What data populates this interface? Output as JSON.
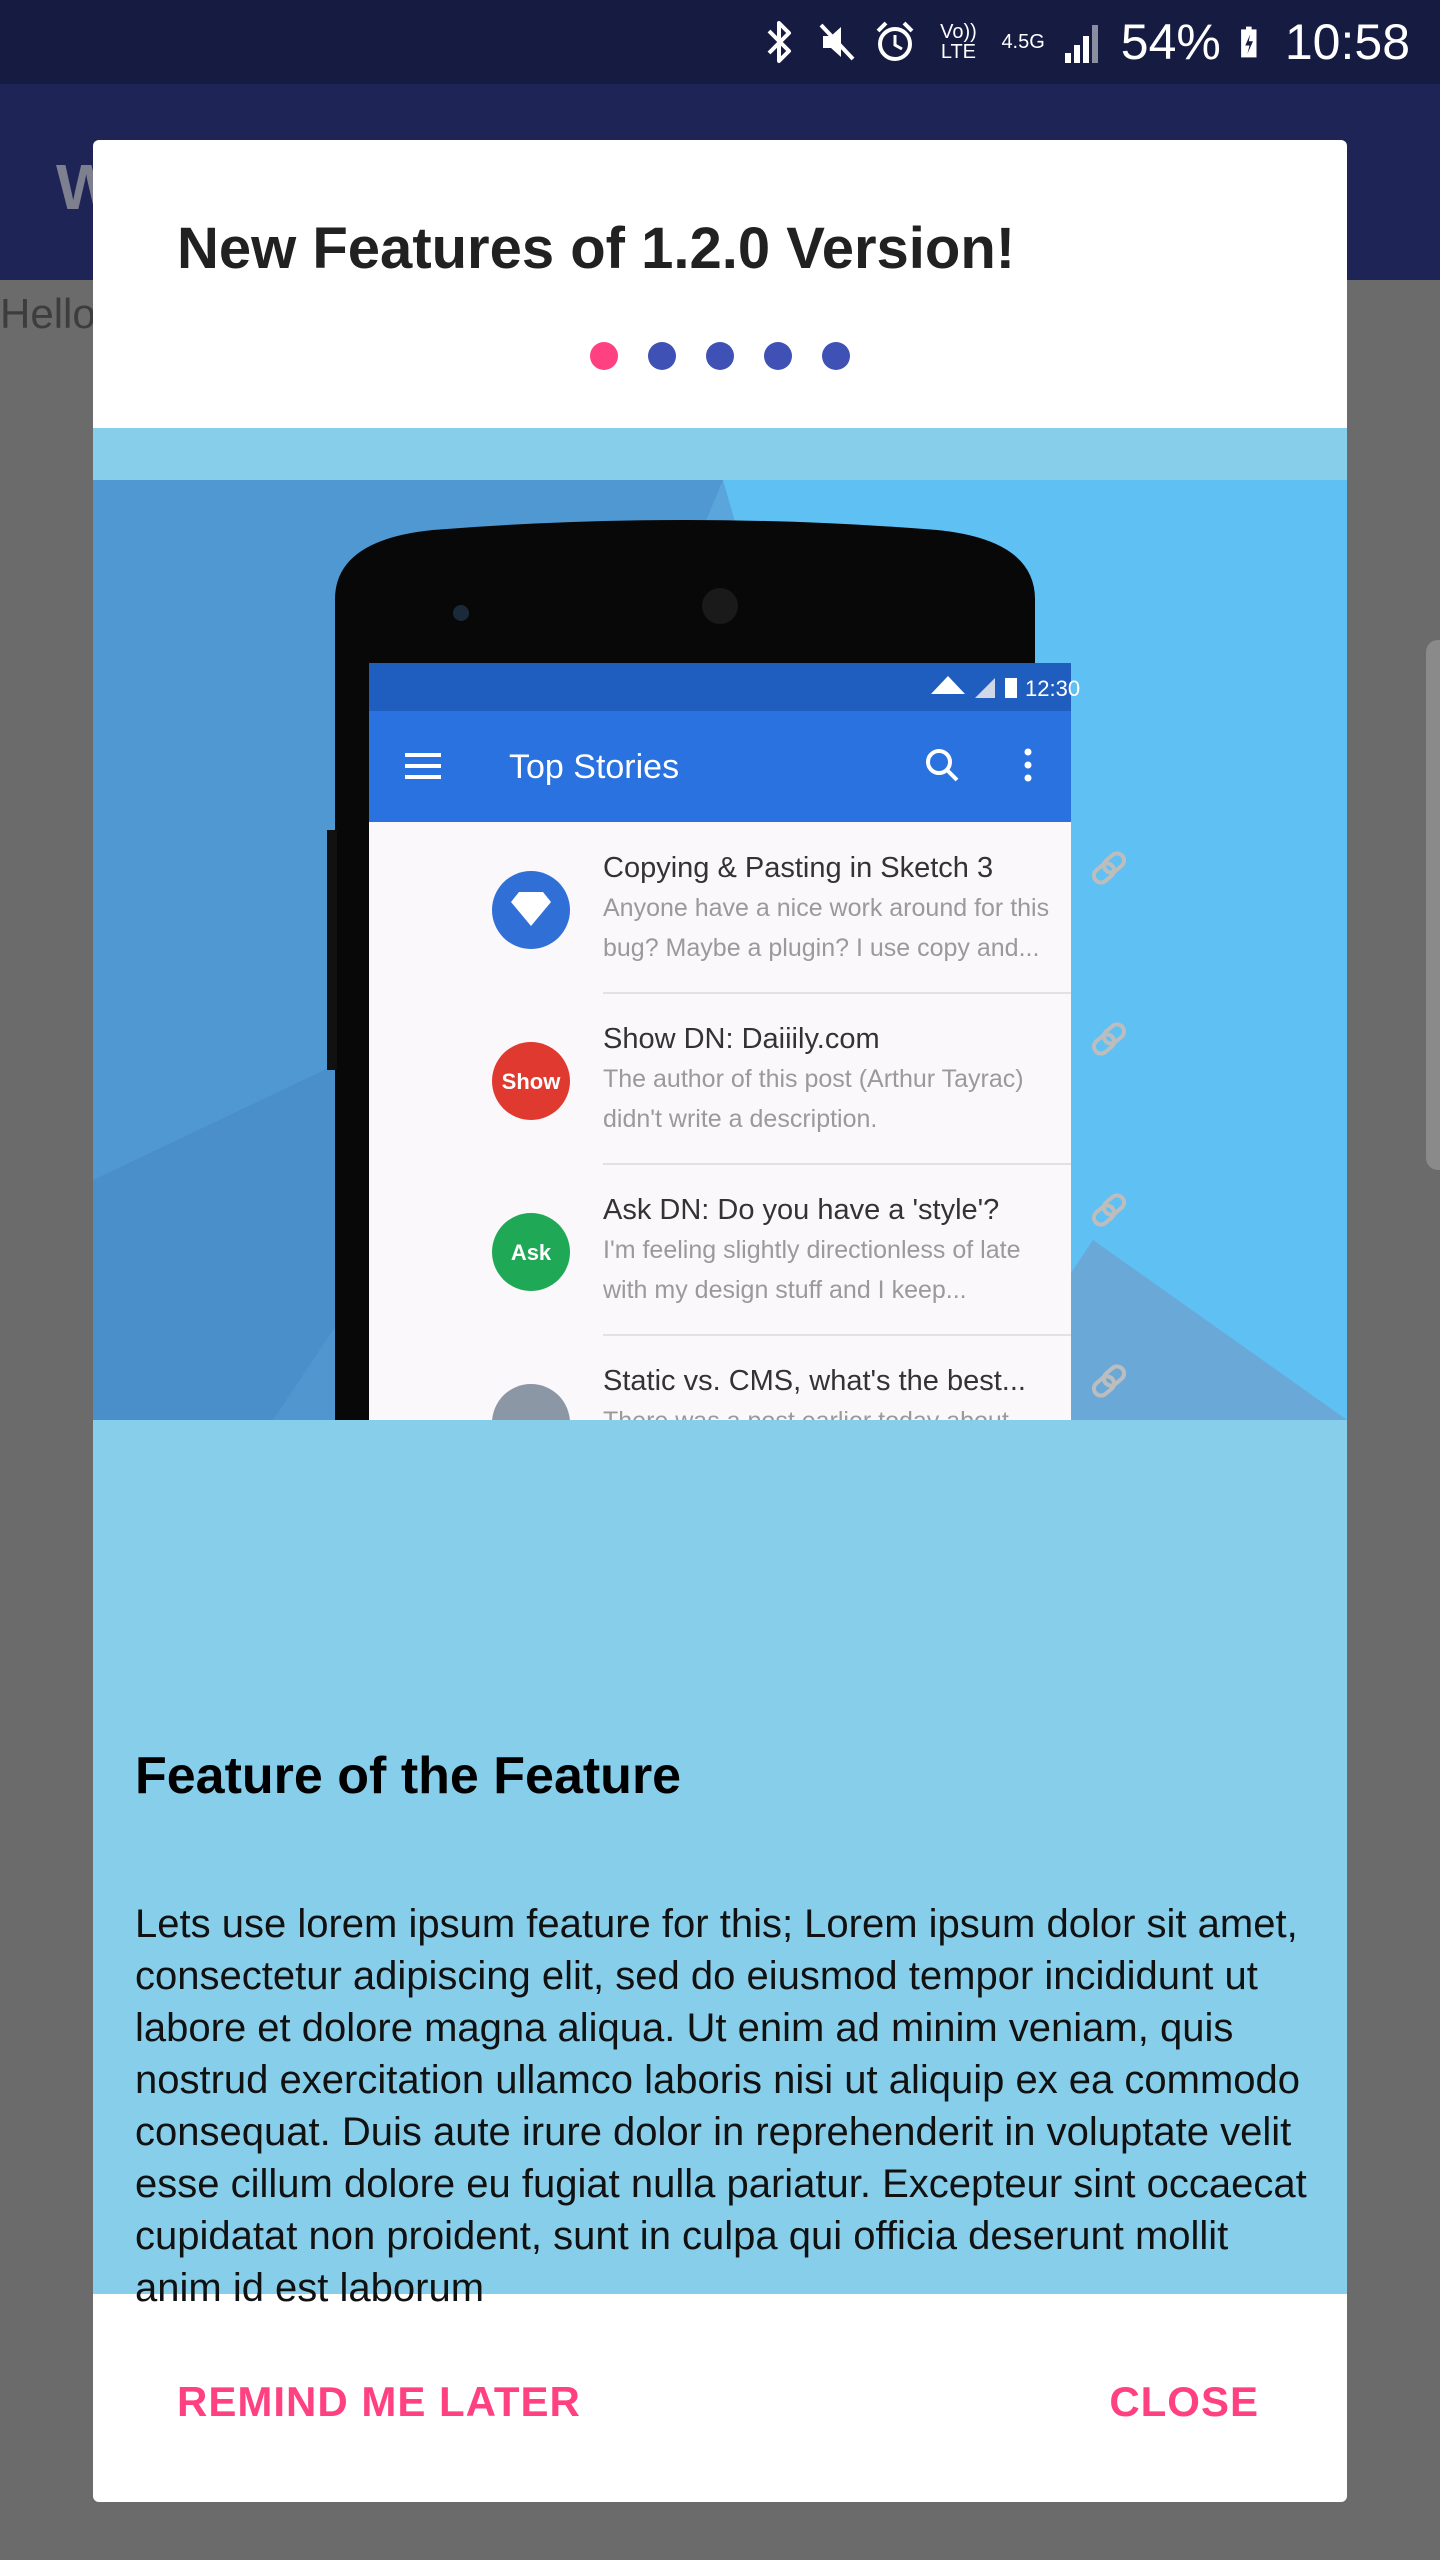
{
  "status_bar": {
    "battery": "54%",
    "time": "10:58",
    "volte_label": "Vo)) LTE",
    "network_label": "4.5G"
  },
  "background_app": {
    "title": "W",
    "body_text": "Hello"
  },
  "dialog": {
    "title": "New Features of 1.2.0 Version!",
    "page_indicator": {
      "count": 5,
      "active_index": 0
    },
    "page": {
      "illustration": {
        "phone_status_time": "12:30",
        "toolbar_title": "Top Stories",
        "stories": [
          {
            "badge": "",
            "badge_color": "#2f6fd6",
            "title": "Copying & Pasting in Sketch 3",
            "line1": "Anyone have a nice work around for this",
            "line2": "bug? Maybe a plugin? I use copy and..."
          },
          {
            "badge": "Show",
            "badge_color": "#e0392f",
            "title": "Show DN: Daiiily.com",
            "line1": "The author of this post (Arthur Tayrac)",
            "line2": "didn't write a description."
          },
          {
            "badge": "Ask",
            "badge_color": "#1fa855",
            "title": "Ask DN: Do you have a 'style'?",
            "line1": "I'm feeling slightly directionless of late",
            "line2": "with my design stuff and I keep..."
          },
          {
            "badge": "",
            "badge_color": "#8c97a6",
            "title": "Static vs. CMS, what's the best...",
            "line1": "There was a post earlier today about",
            "line2": ""
          }
        ]
      },
      "heading": "Feature of the Feature",
      "body": "Lets use lorem ipsum feature for this; Lorem ipsum dolor sit amet, consectetur adipiscing elit, sed do eiusmod tempor incididunt ut labore et dolore magna aliqua. Ut enim ad minim veniam, quis nostrud exercitation ullamco laboris nisi ut aliquip ex ea commodo consequat. Duis aute irure dolor in reprehenderit in voluptate velit esse cillum dolore eu fugiat nulla pariatur. Excepteur sint occaecat cupidatat non proident, sunt in culpa qui officia deserunt mollit anim id est laborum"
    },
    "buttons": {
      "remind": "REMIND ME LATER",
      "close": "CLOSE"
    }
  },
  "colors": {
    "status_bar": "#161b42",
    "app_toolbar": "#1e2456",
    "dot_active": "#ff4081",
    "dot_inactive": "#3f51b5",
    "page_bg": "#87ceeb",
    "button_text": "#ff4081",
    "phone_toolbar": "#2a72df"
  }
}
